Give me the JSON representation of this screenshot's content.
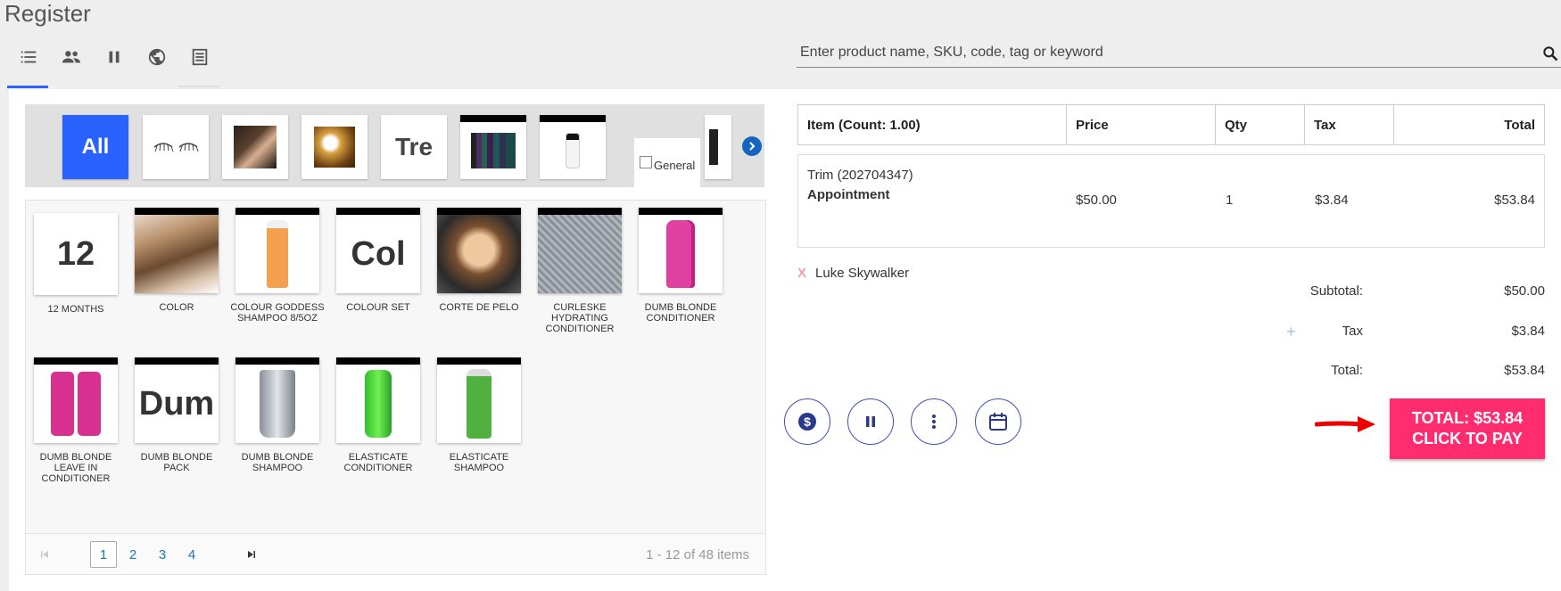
{
  "page": {
    "title": "Register"
  },
  "toolbar": {
    "icons": [
      "list-icon",
      "people-icon",
      "pause-icon",
      "globe-icon",
      "receipt-icon"
    ]
  },
  "search": {
    "placeholder": "Enter product name, SKU, code, tag or keyword",
    "value": ""
  },
  "categories": {
    "all_label": "All",
    "text_tile": "Tre",
    "general_label": "General"
  },
  "products": [
    {
      "name": "12 MONTHS",
      "tile_text": "12"
    },
    {
      "name": "COLOR"
    },
    {
      "name": "COLOUR GODDESS SHAMPOO 8/5OZ"
    },
    {
      "name": "COLOUR SET",
      "tile_text": "Col"
    },
    {
      "name": "CORTE DE PELO"
    },
    {
      "name": "CURLESKE HYDRATING CONDITIONER"
    },
    {
      "name": "DUMB BLONDE CONDITIONER"
    },
    {
      "name": "DUMB BLONDE LEAVE IN CONDITIONER"
    },
    {
      "name": "DUMB BLONDE PACK",
      "tile_text": "Dum"
    },
    {
      "name": "DUMB BLONDE SHAMPOO"
    },
    {
      "name": "ELASTICATE CONDITIONER"
    },
    {
      "name": "ELASTICATE SHAMPOO"
    }
  ],
  "pager": {
    "pages": [
      "1",
      "2",
      "3",
      "4"
    ],
    "current": "1",
    "info": "1 - 12 of 48 items"
  },
  "cart": {
    "headers": {
      "item": "Item (Count: 1.00)",
      "price": "Price",
      "qty": "Qty",
      "tax": "Tax",
      "total": "Total"
    },
    "rows": [
      {
        "name": "Trim (202704347)",
        "type": "Appointment",
        "price": "$50.00",
        "qty": "1",
        "tax": "$3.84",
        "total": "$53.84"
      }
    ],
    "customer": {
      "remove": "X",
      "name": "Luke Skywalker"
    },
    "totals": {
      "subtotal_label": "Subtotal:",
      "subtotal": "$50.00",
      "tax_label": "Tax",
      "tax": "$3.84",
      "total_label": "Total:",
      "total": "$53.84"
    }
  },
  "pay_button": {
    "line1": "TOTAL: $53.84",
    "line2": "CLICK TO PAY"
  },
  "colors": {
    "accent": "#2962ff",
    "pay": "#ff2d6f",
    "action_border": "#3f51b5",
    "link": "#1e73be"
  }
}
